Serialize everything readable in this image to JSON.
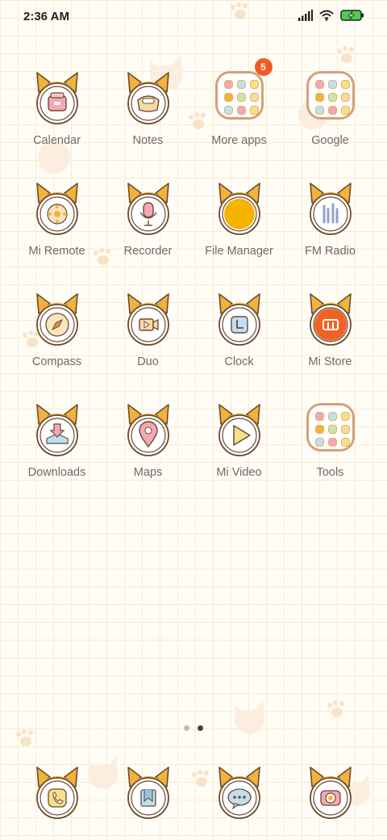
{
  "status_bar": {
    "time": "2:36 AM",
    "icons": [
      "signal-icon",
      "wifi-icon",
      "battery-charging-icon"
    ]
  },
  "apps": [
    {
      "id": "calendar",
      "label": "Calendar",
      "icon": "calendar-icon"
    },
    {
      "id": "notes",
      "label": "Notes",
      "icon": "notes-icon"
    },
    {
      "id": "more-apps",
      "label": "More apps",
      "icon": "folder-icon",
      "badge": "5"
    },
    {
      "id": "google",
      "label": "Google",
      "icon": "folder-icon"
    },
    {
      "id": "mi-remote",
      "label": "Mi Remote",
      "icon": "remote-icon"
    },
    {
      "id": "recorder",
      "label": "Recorder",
      "icon": "microphone-icon"
    },
    {
      "id": "file-manager",
      "label": "File Manager",
      "icon": "file-manager-icon"
    },
    {
      "id": "fm-radio",
      "label": "FM Radio",
      "icon": "radio-icon"
    },
    {
      "id": "compass",
      "label": "Compass",
      "icon": "compass-icon"
    },
    {
      "id": "duo",
      "label": "Duo",
      "icon": "video-camera-icon"
    },
    {
      "id": "clock",
      "label": "Clock",
      "icon": "clock-icon"
    },
    {
      "id": "mi-store",
      "label": "Mi Store",
      "icon": "mi-store-icon"
    },
    {
      "id": "downloads",
      "label": "Downloads",
      "icon": "download-icon"
    },
    {
      "id": "maps",
      "label": "Maps",
      "icon": "map-pin-icon"
    },
    {
      "id": "mi-video",
      "label": "Mi Video",
      "icon": "play-icon"
    },
    {
      "id": "tools",
      "label": "Tools",
      "icon": "folder-icon"
    }
  ],
  "page_indicator": {
    "pages": 2,
    "current": 2
  },
  "dock": [
    {
      "id": "phone",
      "icon": "phone-icon"
    },
    {
      "id": "contacts",
      "icon": "bookmark-icon"
    },
    {
      "id": "messages",
      "icon": "message-icon"
    },
    {
      "id": "camera",
      "icon": "camera-icon"
    }
  ],
  "colors": {
    "background": "#fffdf5",
    "grid_line": "#f6ecd2",
    "cat_ear": "#f2b33d",
    "icon_outline": "#6b4a2f",
    "badge": "#f05a22",
    "label": "#6b6b6b"
  }
}
